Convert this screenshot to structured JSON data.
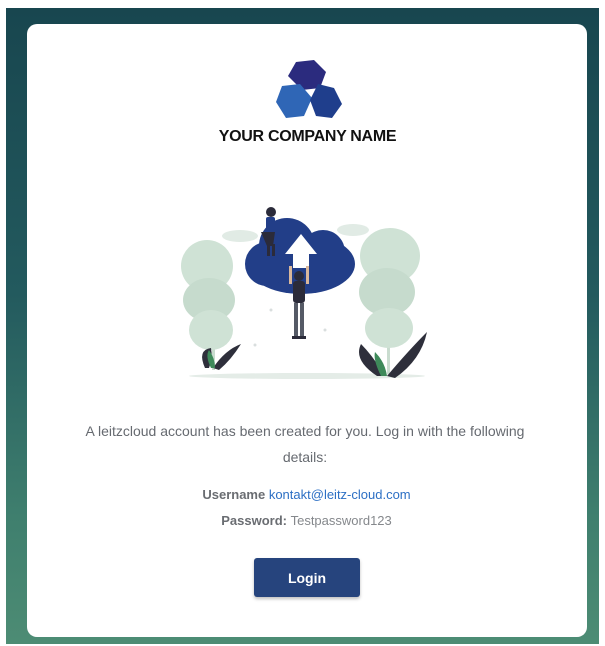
{
  "company": {
    "name": "YOUR COMPANY NAME",
    "logo_icon": "hexagon-cluster-logo"
  },
  "illustration": {
    "icon": "cloud-upload-illustration"
  },
  "message": "A leitzcloud account has been created for you. Log in with the following details:",
  "credentials": {
    "username_label": "Username",
    "username_value": "kontakt@leitz-cloud.com",
    "password_label": "Password:",
    "password_value": "Testpassword123"
  },
  "login_button": {
    "label": "Login"
  },
  "colors": {
    "background_top": "#18464f",
    "background_bottom": "#4d8c74",
    "button": "#26447d",
    "link": "#2c6fc4",
    "logo_dark": "#2b2b7e",
    "logo_mid": "#2f66b6",
    "logo_navy": "#1f3e8c"
  }
}
